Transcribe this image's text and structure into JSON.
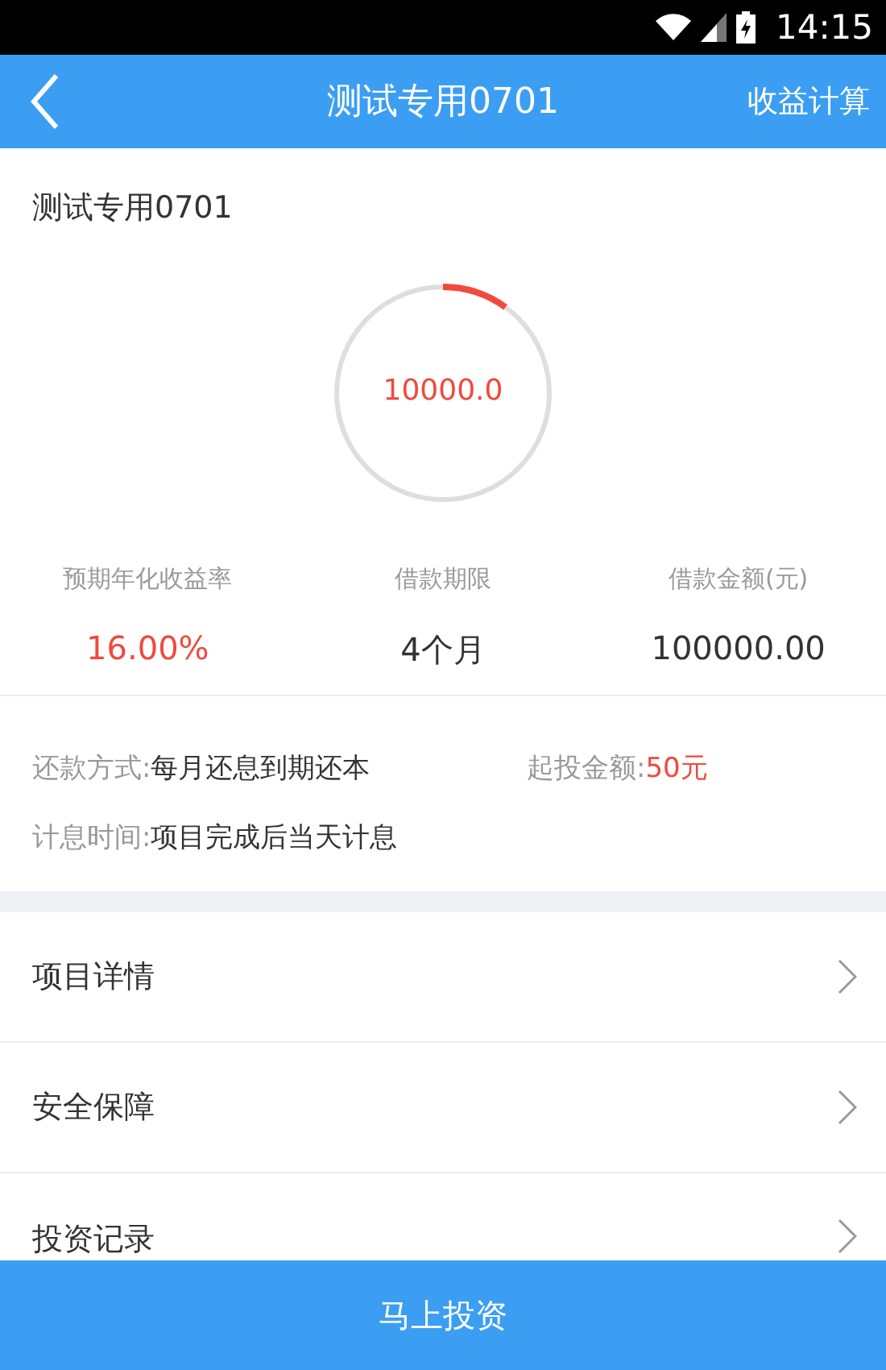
{
  "status_bar": {
    "time": "14:15"
  },
  "nav": {
    "title": "测试专用0701",
    "action": "收益计算"
  },
  "product": {
    "name": "测试专用0701",
    "ring": {
      "amount": "10000.0"
    }
  },
  "stats": [
    {
      "label": "预期年化收益率",
      "value": "16.00%",
      "highlight": true
    },
    {
      "label": "借款期限",
      "value": "4个月",
      "highlight": false
    },
    {
      "label": "借款金额(元)",
      "value": "100000.00",
      "highlight": false
    }
  ],
  "info": [
    [
      {
        "label": "还款方式:",
        "value": "每月还息到期还本",
        "highlight": false
      },
      {
        "label": "起投金额:",
        "value": "50元",
        "highlight": true
      }
    ],
    [
      {
        "label": "计息时间:",
        "value": "项目完成后当天计息",
        "highlight": false
      }
    ]
  ],
  "menu": [
    "项目详情",
    "安全保障",
    "投资记录"
  ],
  "invest_button": "马上投资"
}
